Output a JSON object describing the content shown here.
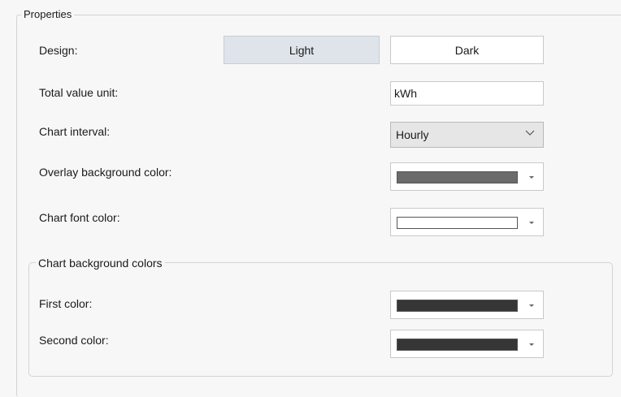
{
  "properties": {
    "title": "Properties",
    "design": {
      "label": "Design:",
      "options": [
        "Light",
        "Dark"
      ],
      "selected": "Light"
    },
    "total_value_unit": {
      "label": "Total value unit:",
      "value": "kWh"
    },
    "chart_interval": {
      "label": "Chart interval:",
      "value": "Hourly"
    },
    "overlay_background_color": {
      "label": "Overlay background color:",
      "color": "#6b6b6b"
    },
    "chart_font_color": {
      "label": "Chart font color:",
      "color": "#ffffff"
    },
    "chart_background_colors": {
      "title": "Chart background colors",
      "first_color": {
        "label": "First color:",
        "color": "#363636"
      },
      "second_color": {
        "label": "Second color:",
        "color": "#363636"
      }
    }
  }
}
